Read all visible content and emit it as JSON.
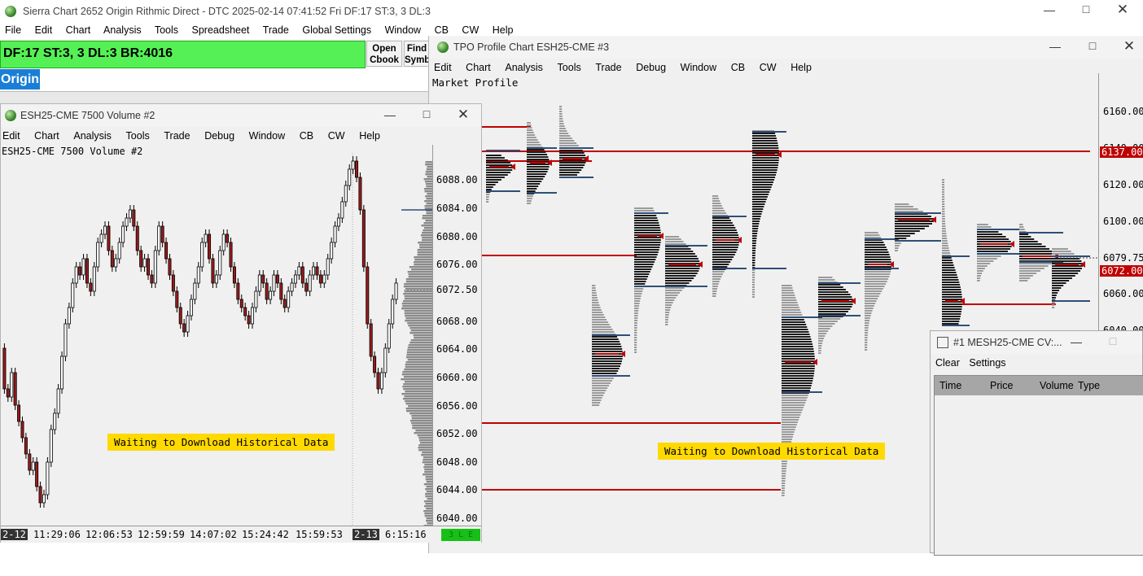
{
  "main": {
    "title": "Sierra Chart 2652 Origin Rithmic Direct - DTC 2025-02-14  07:41:52 Fri DF:17  ST:3, 3  DL:3",
    "menu": [
      "File",
      "Edit",
      "Chart",
      "Analysis",
      "Tools",
      "Spreadsheet",
      "Trade",
      "Global Settings",
      "Window",
      "CB",
      "CW",
      "Help"
    ],
    "status": "DF:17  ST:3, 3  DL:3  BR:4016",
    "open_cbook": [
      "Open",
      "Cbook"
    ],
    "find_symbol": [
      "Find",
      "Symb"
    ],
    "origin": "Origin"
  },
  "tpo": {
    "title": "TPO Profile Chart ESH25-CME #3",
    "menu": [
      "Edit",
      "Chart",
      "Analysis",
      "Tools",
      "Trade",
      "Debug",
      "Window",
      "CB",
      "CW",
      "Help"
    ],
    "study_label": "Market Profile",
    "y_ticks": [
      "6160.00",
      "6140.00",
      "6120.00",
      "6100.00",
      "6079.75",
      "6060.00",
      "6040.00"
    ],
    "badges": [
      "6137.00",
      "6072.00"
    ],
    "waiting": "Waiting to Download Historical Data"
  },
  "vol": {
    "title": "ESH25-CME  7500 Volume #2",
    "menu": [
      "Edit",
      "Chart",
      "Analysis",
      "Tools",
      "Trade",
      "Debug",
      "Window",
      "CB",
      "CW",
      "Help"
    ],
    "chart_label": "ESH25-CME  7500 Volume #2",
    "y_ticks": [
      "6088.00",
      "6084.00",
      "6080.00",
      "6076.00",
      "6072.50",
      "6068.00",
      "6064.00",
      "6060.00",
      "6056.00",
      "6052.00",
      "6048.00",
      "6044.00",
      "6040.00"
    ],
    "x_labels": [
      "2-12",
      "11:29:06",
      "12:06:53",
      "12:59:59",
      "14:07:02",
      "15:24:42",
      "15:59:53",
      "2-13",
      "6:15:16"
    ],
    "status_badge": "3 L E",
    "waiting": "Waiting to Download Historical Data"
  },
  "tas": {
    "title": "#1 MESH25-CME  CV:...",
    "menu": [
      "Clear",
      "Settings"
    ],
    "columns": [
      "Time",
      "Price",
      "Volume",
      "Type"
    ]
  },
  "colors": {
    "status_green": "#55f055",
    "origin_blue": "#1a7ed6",
    "tpo_red": "#c00000",
    "tpo_blue": "#2d4f78",
    "candle_red": "#9b1b1b"
  }
}
